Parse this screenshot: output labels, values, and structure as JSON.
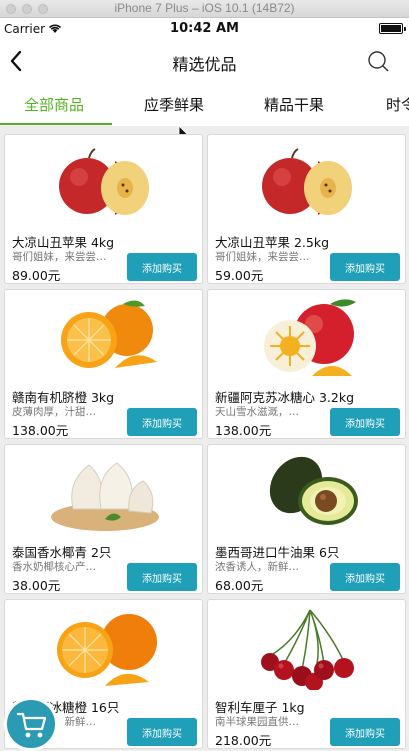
{
  "simulator": {
    "title": "iPhone 7 Plus – iOS 10.1 (14B72)"
  },
  "status_bar": {
    "carrier": "Carrier",
    "time": "10:42 AM"
  },
  "nav": {
    "title": "精选优品",
    "back_icon": "chevron-left-icon",
    "search_icon": "search-icon"
  },
  "tabs": [
    {
      "label": "全部商品",
      "active": true
    },
    {
      "label": "应季鲜果",
      "active": false
    },
    {
      "label": "精品干果",
      "active": false
    },
    {
      "label": "时令",
      "active": false
    }
  ],
  "colors": {
    "accent": "#5ab025",
    "button": "#1f9fb8",
    "fab": "#2b9ab3"
  },
  "products": [
    {
      "name": "大凉山丑苹果 4kg",
      "desc": "哥们姐妹，来尝尝…",
      "price": "89.00元",
      "button": "添加购买",
      "image": "apple"
    },
    {
      "name": "大凉山丑苹果 2.5kg",
      "desc": "哥们姐妹，来尝尝…",
      "price": "59.00元",
      "button": "添加购买",
      "image": "apple"
    },
    {
      "name": "赣南有机脐橙 3kg",
      "desc": "皮薄肉厚，汁甜…",
      "price": "138.00元",
      "button": "添加购买",
      "image": "orange"
    },
    {
      "name": "新疆阿克苏冰糖心 3.2kg",
      "desc": "天山雪水滋溉，…",
      "price": "138.00元",
      "button": "添加购买",
      "image": "red-apple"
    },
    {
      "name": "泰国香水椰青 2只",
      "desc": "香水奶椰核心产…",
      "price": "38.00元",
      "button": "添加购买",
      "image": "coconut"
    },
    {
      "name": "墨西哥进口牛油果 6只",
      "desc": "浓香诱人，新鲜…",
      "price": "68.00元",
      "button": "添加购买",
      "image": "avocado"
    },
    {
      "name": "赣南兴冰糖橙 16只",
      "desc": "浓香诱人，新鲜…",
      "price": "",
      "button": "添加购买",
      "image": "orange"
    },
    {
      "name": "智利车厘子 1kg",
      "desc": "南半球果园直供…",
      "price": "218.00元",
      "button": "添加购买",
      "image": "cherry"
    }
  ],
  "cart": {
    "icon": "cart-icon"
  }
}
